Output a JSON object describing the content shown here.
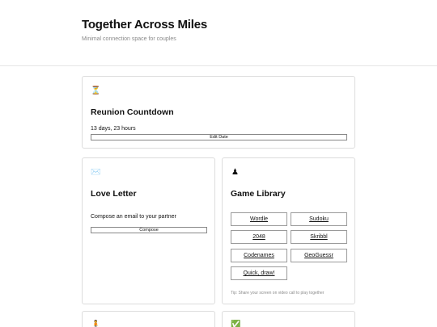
{
  "header": {
    "title": "Together Across Miles",
    "subtitle": "Minimal connection space for couples"
  },
  "countdown": {
    "icon": "hourglass-icon",
    "icon_glyph": "⏳",
    "title": "Reunion Countdown",
    "value": "13 days, 23 hours",
    "button_label": "Edit Date"
  },
  "letter": {
    "icon": "envelope-icon",
    "icon_glyph": "✉️",
    "title": "Love Letter",
    "description": "Compose an email to your partner",
    "button_label": "Compose"
  },
  "games": {
    "icon": "chess-pawn-icon",
    "icon_glyph": "♟",
    "title": "Game Library",
    "items": [
      "Wordle",
      "Sudoku",
      "2048",
      "Skribbl",
      "Codenames",
      "GeoGuessr",
      "Quick, draw!"
    ],
    "tip": "Tip: Share your screen on video call to play together"
  },
  "bottom_cards": {
    "left_icon": "person-icon",
    "left_glyph": "🧍",
    "right_icon": "checkmark-icon",
    "right_glyph": "✅"
  }
}
